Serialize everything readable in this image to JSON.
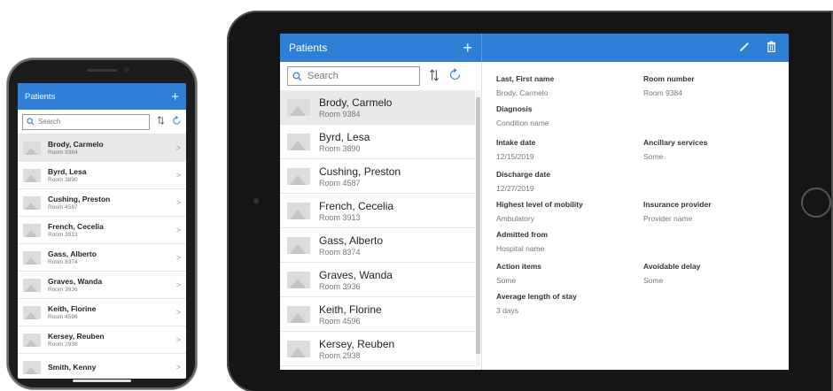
{
  "app": {
    "title": "Patients"
  },
  "search": {
    "placeholder": "Search"
  },
  "patients": [
    {
      "name": "Brody, Carmelo",
      "room": "Room 9384"
    },
    {
      "name": "Byrd, Lesa",
      "room": "Room 3890"
    },
    {
      "name": "Cushing, Preston",
      "room": "Room 4587"
    },
    {
      "name": "French, Cecelia",
      "room": "Room 3913"
    },
    {
      "name": "Gass, Alberto",
      "room": "Room 8374"
    },
    {
      "name": "Graves, Wanda",
      "room": "Room 3936"
    },
    {
      "name": "Keith, Florine",
      "room": "Room 4596"
    },
    {
      "name": "Kersey, Reuben",
      "room": "Room 2938"
    },
    {
      "name": "Smith, Kenny",
      "room": ""
    }
  ],
  "detail": {
    "name_label": "Last, First name",
    "name_value": "Brody, Carmelo",
    "room_label": "Room number",
    "room_value": "Room 9384",
    "diagnosis_label": "Diagnosis",
    "diagnosis_value": "Condition name",
    "intake_label": "Intake date",
    "intake_value": "12/15/2019",
    "ancillary_label": "Ancillary services",
    "ancillary_value": "Some",
    "discharge_label": "Discharge date",
    "discharge_value": "12/27/2019",
    "mobility_label": "Highest level of mobility",
    "mobility_value": "Ambulatory",
    "insurance_label": "Insurance provider",
    "insurance_value": "Provider name",
    "admitted_label": "Admitted from",
    "admitted_value": "Hospital name",
    "actions_label": "Action items",
    "actions_value": "Some",
    "delay_label": "Avoidable delay",
    "delay_value": "Some",
    "stay_label": "Average length of stay",
    "stay_value": "3 days"
  },
  "icons": {
    "plus": "+",
    "search": "search-icon",
    "sort": "sort-icon",
    "refresh": "refresh-icon",
    "edit": "pencil-icon",
    "delete": "trash-icon",
    "chevron": "chevron-right-icon"
  },
  "colors": {
    "accent": "#2f7fd6",
    "selected_row": "#e9e9e9"
  }
}
